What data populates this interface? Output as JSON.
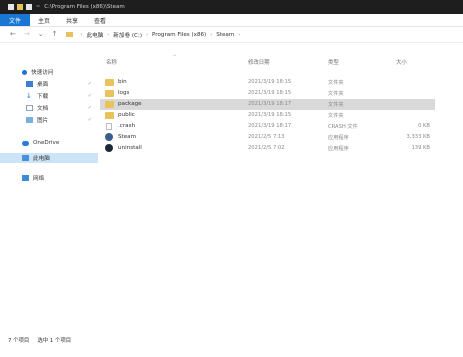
{
  "titlebar": {
    "title": "C:\\Program Files (x86)\\Steam",
    "separator": "="
  },
  "ribbon": {
    "tabs": [
      "文件",
      "主页",
      "共享",
      "查看"
    ]
  },
  "address": {
    "back": "←",
    "forward": "→",
    "recent": "⌄",
    "up": "↑",
    "crumbs": [
      "此电脑",
      "新加卷 (C:)",
      "Program Files (x86)",
      "Steam"
    ]
  },
  "sidebar": {
    "items": [
      {
        "label": "快速访问",
        "icon": "star-icon"
      },
      {
        "label": "桌面",
        "icon": "desktop-icon"
      },
      {
        "label": "下载",
        "icon": "download-icon"
      },
      {
        "label": "文档",
        "icon": "document-icon"
      },
      {
        "label": "图片",
        "icon": "picture-icon"
      },
      {
        "label": "OneDrive",
        "icon": "cloud-icon"
      },
      {
        "label": "此电脑",
        "icon": "computer-icon"
      },
      {
        "label": "网络",
        "icon": "network-icon"
      }
    ]
  },
  "columns": {
    "name": "名称",
    "date": "修改日期",
    "type": "类型",
    "size": "大小"
  },
  "files": [
    {
      "name": "bin",
      "date": "2021/3/19 18:15",
      "type": "文件夹",
      "size": "",
      "icon": "folder-icon"
    },
    {
      "name": "logs",
      "date": "2021/3/19 18:15",
      "type": "文件夹",
      "size": "",
      "icon": "folder-icon"
    },
    {
      "name": "package",
      "date": "2021/3/19 18:17",
      "type": "文件夹",
      "size": "",
      "icon": "folder-icon"
    },
    {
      "name": "public",
      "date": "2021/3/19 18:15",
      "type": "文件夹",
      "size": "",
      "icon": "folder-icon"
    },
    {
      "name": ".crash",
      "date": "2021/3/19 18:17",
      "type": "CRASH 文件",
      "size": "0 KB",
      "icon": "file-icon"
    },
    {
      "name": "Steam",
      "date": "2021/2/5 7:13",
      "type": "应用程序",
      "size": "3,333 KB",
      "icon": "steam-icon"
    },
    {
      "name": "uninstall",
      "date": "2021/2/5 7:02",
      "type": "应用程序",
      "size": "139 KB",
      "icon": "uninstall-icon"
    }
  ],
  "status": {
    "count": "7 个项目",
    "selected": "选中 1 个项目"
  },
  "colors": {
    "accent": "#1976d2",
    "folder": "#e8c25a",
    "selection": "#d9d9d9"
  }
}
